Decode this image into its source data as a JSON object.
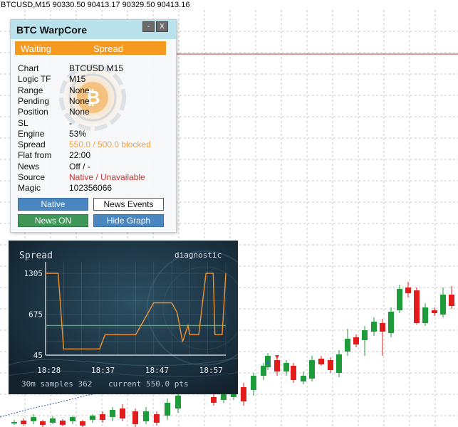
{
  "header": {
    "symbol": "BTCUSD,M15",
    "ohlc": "90330.50 90413.17 90329.50 90413.16"
  },
  "panel": {
    "title": "BTC WarpCore",
    "minimize": "-",
    "close": "X",
    "status_left": "Waiting",
    "status_right": "Spread",
    "rows": [
      {
        "key": "Chart",
        "value": "BTCUSD M15"
      },
      {
        "key": "Logic TF",
        "value": "M15"
      },
      {
        "key": "Range",
        "value": "None"
      },
      {
        "key": "Pending",
        "value": "None"
      },
      {
        "key": "Position",
        "value": "None"
      },
      {
        "key": "SL",
        "value": "-"
      },
      {
        "key": "Engine",
        "value": "53%"
      },
      {
        "key": "Spread",
        "value": "550.0 / 500.0 blocked"
      },
      {
        "key": "Flat from",
        "value": "22:00"
      },
      {
        "key": "News",
        "value": "Off / -"
      },
      {
        "key": "Source",
        "value": "Native / Unavailable"
      },
      {
        "key": "Magic",
        "value": "102356066"
      }
    ],
    "buttons": {
      "native": "Native",
      "news_events": "News Events",
      "news_on": "News ON",
      "hide_graph": "Hide Graph"
    }
  },
  "diagnostic": {
    "title": "Spread",
    "mode": "diagnostic",
    "footer_samples": "30m samples 362",
    "footer_current": "current 550.0 pts"
  },
  "chart_data": {
    "type": "line",
    "title": "Spread",
    "x_ticks": [
      "18:28",
      "18:37",
      "18:47",
      "18:57"
    ],
    "y_ticks": [
      "1305",
      "675",
      "45"
    ],
    "ylim": [
      45,
      1305
    ],
    "threshold": 500,
    "series": [
      {
        "x": [
          0,
          0.07,
          0.1,
          0.13,
          0.3,
          0.33,
          0.42,
          0.5,
          0.6,
          0.62,
          0.7,
          0.73,
          0.76,
          0.79,
          0.8,
          0.85,
          0.89,
          0.93,
          0.94,
          0.98,
          1.0
        ],
        "values": [
          1305,
          1305,
          140,
          140,
          140,
          360,
          360,
          360,
          850,
          850,
          850,
          700,
          250,
          500,
          360,
          360,
          1305,
          1305,
          360,
          360,
          1305
        ]
      }
    ],
    "colors": {
      "line": "#f0922e",
      "threshold": "#41b86a"
    }
  },
  "colors": {
    "bull": "#1f9c3a",
    "bear": "#e21b1b",
    "price_line": "#c0392b",
    "title_bar": "#b9e2ec",
    "status_bar": "#f59a1e"
  }
}
